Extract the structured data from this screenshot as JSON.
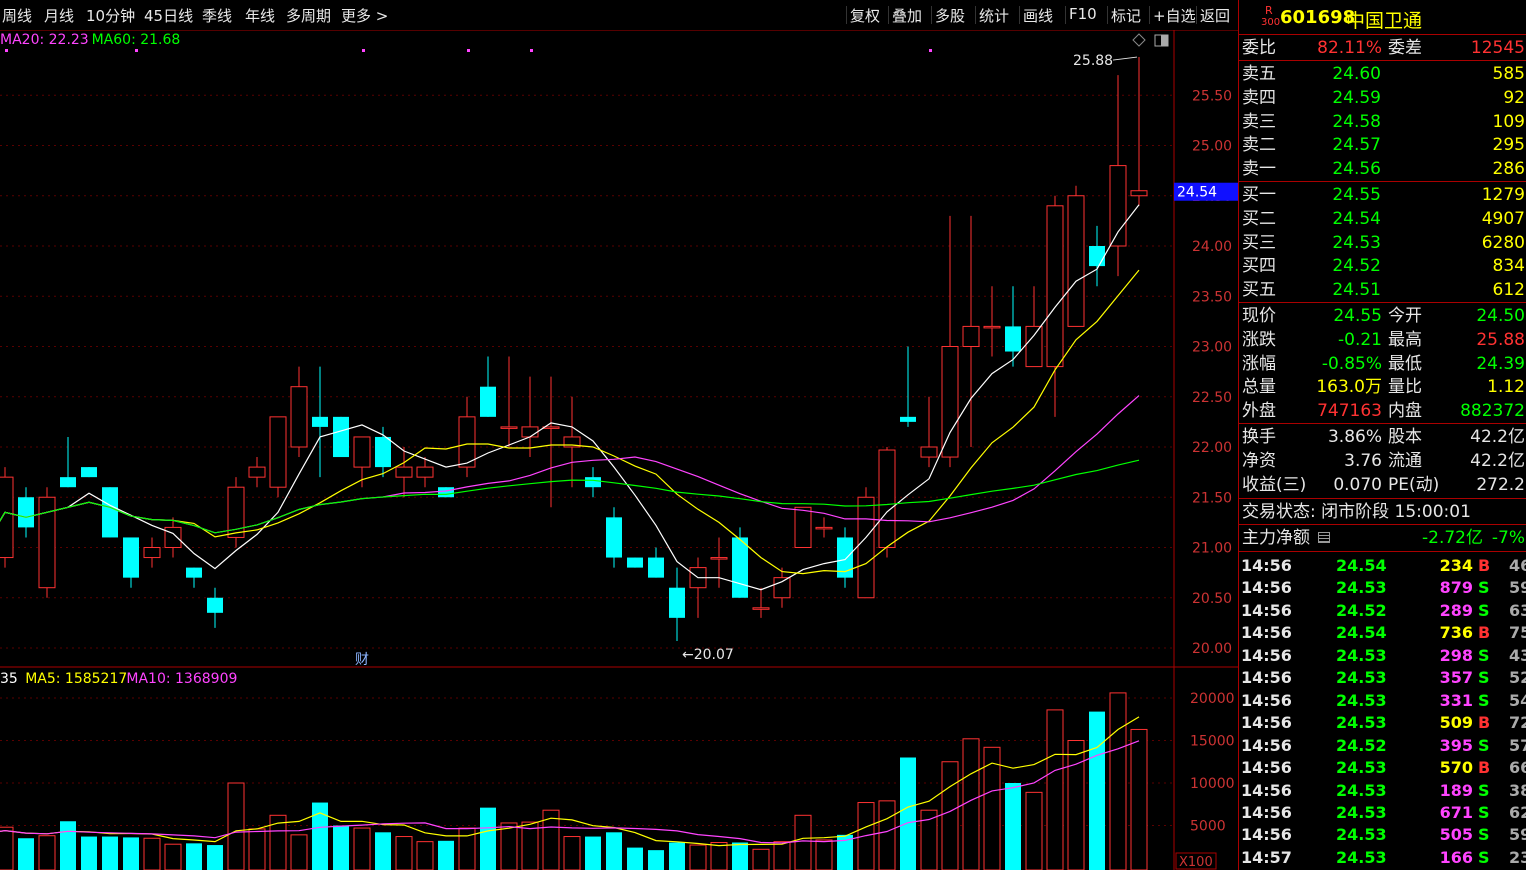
{
  "toolbar": {
    "left_items": [
      "周线",
      "月线",
      "10分钟",
      "45日线",
      "季线",
      "年线",
      "多周期",
      "更多 >"
    ],
    "right_items": [
      "复权",
      "叠加",
      "多股",
      "统计",
      "画线",
      "F10",
      "标记",
      "+自选",
      "返回"
    ]
  },
  "price_chart": {
    "ma_legend": [
      {
        "label": "MA20: 22.23",
        "color": "#ff44ff"
      },
      {
        "label": "MA60: 21.68",
        "color": "#00ff00"
      }
    ],
    "y_ticks": [
      "25.50",
      "25.00",
      "24.50",
      "24.00",
      "23.50",
      "23.00",
      "22.50",
      "22.00",
      "21.50",
      "21.00",
      "20.50",
      "20.00"
    ],
    "current_price_tag": "24.54",
    "high_annotation": "25.88",
    "low_annotation": "20.07",
    "finance_marker": "财",
    "icon_diamond": "diamond-icon",
    "icon_window": "window-icon"
  },
  "volume_chart": {
    "ma_legend": [
      {
        "label": "35",
        "color": "#ffffff"
      },
      {
        "label": "MA5: 1585217",
        "color": "#ffff00"
      },
      {
        "label": "MA10: 1368909",
        "color": "#ff44ff"
      }
    ],
    "y_ticks": [
      "20000",
      "15000",
      "10000",
      "5000"
    ],
    "unit_label": "X100"
  },
  "chart_data": {
    "type": "candlestick",
    "price_ylim": [
      20.0,
      25.8
    ],
    "volume_ylim": [
      0,
      20000
    ],
    "volume_unit": "X100",
    "candles": [
      {
        "o": 21.2,
        "h": 21.4,
        "l": 20.9,
        "c": 21.0,
        "v": 4000
      },
      {
        "o": 20.9,
        "h": 21.8,
        "l": 20.8,
        "c": 21.7,
        "v": 4800
      },
      {
        "o": 21.5,
        "h": 21.6,
        "l": 21.1,
        "c": 21.2,
        "v": 3500
      },
      {
        "o": 20.6,
        "h": 21.6,
        "l": 20.5,
        "c": 21.5,
        "v": 3800
      },
      {
        "o": 21.7,
        "h": 22.1,
        "l": 21.6,
        "c": 21.6,
        "v": 5500
      },
      {
        "o": 21.8,
        "h": 21.8,
        "l": 21.7,
        "c": 21.7,
        "v": 3700
      },
      {
        "o": 21.6,
        "h": 21.6,
        "l": 21.1,
        "c": 21.1,
        "v": 3700
      },
      {
        "o": 21.1,
        "h": 21.1,
        "l": 20.6,
        "c": 20.7,
        "v": 3600
      },
      {
        "o": 20.9,
        "h": 21.1,
        "l": 20.8,
        "c": 21.0,
        "v": 3500
      },
      {
        "o": 21.0,
        "h": 21.3,
        "l": 20.9,
        "c": 21.2,
        "v": 2800
      },
      {
        "o": 20.8,
        "h": 20.8,
        "l": 20.6,
        "c": 20.7,
        "v": 2900
      },
      {
        "o": 20.5,
        "h": 20.6,
        "l": 20.2,
        "c": 20.35,
        "v": 2700
      },
      {
        "o": 21.1,
        "h": 21.7,
        "l": 21.0,
        "c": 21.6,
        "v": 10000
      },
      {
        "o": 21.7,
        "h": 21.9,
        "l": 21.6,
        "c": 21.8,
        "v": 4600
      },
      {
        "o": 21.6,
        "h": 22.3,
        "l": 21.5,
        "c": 22.3,
        "v": 6200
      },
      {
        "o": 22.0,
        "h": 22.8,
        "l": 21.9,
        "c": 22.6,
        "v": 3900
      },
      {
        "o": 22.3,
        "h": 22.8,
        "l": 21.7,
        "c": 22.2,
        "v": 7700
      },
      {
        "o": 22.3,
        "h": 22.3,
        "l": 21.9,
        "c": 21.9,
        "v": 5000
      },
      {
        "o": 21.8,
        "h": 22.1,
        "l": 21.6,
        "c": 22.1,
        "v": 4700
      },
      {
        "o": 22.1,
        "h": 22.2,
        "l": 21.7,
        "c": 21.8,
        "v": 4200
      },
      {
        "o": 21.7,
        "h": 22.0,
        "l": 21.5,
        "c": 21.8,
        "v": 3700
      },
      {
        "o": 21.7,
        "h": 21.9,
        "l": 21.6,
        "c": 21.8,
        "v": 3100
      },
      {
        "o": 21.6,
        "h": 21.6,
        "l": 21.5,
        "c": 21.5,
        "v": 3200
      },
      {
        "o": 21.8,
        "h": 22.5,
        "l": 21.7,
        "c": 22.3,
        "v": 4700
      },
      {
        "o": 22.6,
        "h": 22.9,
        "l": 22.3,
        "c": 22.3,
        "v": 7100
      },
      {
        "o": 22.2,
        "h": 22.9,
        "l": 22.0,
        "c": 22.2,
        "v": 5300
      },
      {
        "o": 22.1,
        "h": 22.7,
        "l": 21.9,
        "c": 22.2,
        "v": 5400
      },
      {
        "o": 22.2,
        "h": 22.7,
        "l": 21.4,
        "c": 22.2,
        "v": 6800
      },
      {
        "o": 22.0,
        "h": 22.5,
        "l": 21.6,
        "c": 22.1,
        "v": 3700
      },
      {
        "o": 21.7,
        "h": 21.8,
        "l": 21.5,
        "c": 21.6,
        "v": 3700
      },
      {
        "o": 21.3,
        "h": 21.4,
        "l": 20.8,
        "c": 20.9,
        "v": 4200
      },
      {
        "o": 20.9,
        "h": 20.9,
        "l": 20.8,
        "c": 20.8,
        "v": 2400
      },
      {
        "o": 20.9,
        "h": 21.0,
        "l": 20.7,
        "c": 20.7,
        "v": 2100
      },
      {
        "o": 20.6,
        "h": 20.8,
        "l": 20.07,
        "c": 20.3,
        "v": 3000
      },
      {
        "o": 20.6,
        "h": 20.9,
        "l": 20.3,
        "c": 20.8,
        "v": 2700
      },
      {
        "o": 20.9,
        "h": 21.1,
        "l": 20.6,
        "c": 20.9,
        "v": 3000
      },
      {
        "o": 21.1,
        "h": 21.2,
        "l": 20.5,
        "c": 20.5,
        "v": 3000
      },
      {
        "o": 20.4,
        "h": 20.6,
        "l": 20.3,
        "c": 20.4,
        "v": 2200
      },
      {
        "o": 20.5,
        "h": 20.8,
        "l": 20.4,
        "c": 20.7,
        "v": 3100
      },
      {
        "o": 21.0,
        "h": 21.4,
        "l": 21.0,
        "c": 21.4,
        "v": 6200
      },
      {
        "o": 21.2,
        "h": 21.3,
        "l": 21.1,
        "c": 21.2,
        "v": 3300
      },
      {
        "o": 21.1,
        "h": 21.2,
        "l": 20.6,
        "c": 20.7,
        "v": 3900
      },
      {
        "o": 20.5,
        "h": 21.6,
        "l": 20.5,
        "c": 21.5,
        "v": 7700
      },
      {
        "o": 21.0,
        "h": 22.0,
        "l": 20.9,
        "c": 21.97,
        "v": 7900
      },
      {
        "o": 22.3,
        "h": 23.0,
        "l": 22.2,
        "c": 22.25,
        "v": 13000
      },
      {
        "o": 21.9,
        "h": 22.5,
        "l": 21.8,
        "c": 22.0,
        "v": 6800
      },
      {
        "o": 21.9,
        "h": 24.3,
        "l": 21.8,
        "c": 23.0,
        "v": 12500
      },
      {
        "o": 23.0,
        "h": 24.3,
        "l": 22.0,
        "c": 23.2,
        "v": 15200
      },
      {
        "o": 23.2,
        "h": 23.6,
        "l": 22.9,
        "c": 23.2,
        "v": 14200
      },
      {
        "o": 23.2,
        "h": 23.6,
        "l": 22.8,
        "c": 22.95,
        "v": 10000
      },
      {
        "o": 22.8,
        "h": 23.6,
        "l": 22.8,
        "c": 23.2,
        "v": 8900
      },
      {
        "o": 22.8,
        "h": 24.5,
        "l": 22.3,
        "c": 24.4,
        "v": 18600
      },
      {
        "o": 23.2,
        "h": 24.6,
        "l": 23.2,
        "c": 24.5,
        "v": 15000
      },
      {
        "o": 24.0,
        "h": 24.2,
        "l": 23.6,
        "c": 23.8,
        "v": 18400
      },
      {
        "o": 24.0,
        "h": 25.7,
        "l": 23.7,
        "c": 24.8,
        "v": 20600
      },
      {
        "o": 24.5,
        "h": 25.88,
        "l": 24.4,
        "c": 24.55,
        "v": 16300
      }
    ]
  },
  "quote": {
    "stock_code": "601698",
    "stock_name": "中国卫通",
    "badge_top": "R",
    "badge_bottom": "300",
    "weibi_label": "委比",
    "weibi_value": "82.11%",
    "weicha_label": "委差",
    "weicha_value": "12545",
    "sell": [
      {
        "label": "卖五",
        "price": "24.60",
        "vol": "585"
      },
      {
        "label": "卖四",
        "price": "24.59",
        "vol": "92"
      },
      {
        "label": "卖三",
        "price": "24.58",
        "vol": "109"
      },
      {
        "label": "卖二",
        "price": "24.57",
        "vol": "295"
      },
      {
        "label": "卖一",
        "price": "24.56",
        "vol": "286"
      }
    ],
    "buy": [
      {
        "label": "买一",
        "price": "24.55",
        "vol": "1279"
      },
      {
        "label": "买二",
        "price": "24.54",
        "vol": "4907"
      },
      {
        "label": "买三",
        "price": "24.53",
        "vol": "6280"
      },
      {
        "label": "买四",
        "price": "24.52",
        "vol": "834"
      },
      {
        "label": "买五",
        "price": "24.51",
        "vol": "612"
      }
    ],
    "stats1": [
      {
        "l1": "现价",
        "v1": "24.55",
        "c1": "g",
        "l2": "今开",
        "v2": "24.50",
        "c2": "g"
      },
      {
        "l1": "涨跌",
        "v1": "-0.21",
        "c1": "g",
        "l2": "最高",
        "v2": "25.88",
        "c2": "r"
      },
      {
        "l1": "涨幅",
        "v1": "-0.85%",
        "c1": "g",
        "l2": "最低",
        "v2": "24.39",
        "c2": "g"
      },
      {
        "l1": "总量",
        "v1": "163.0万",
        "c1": "y",
        "l2": "量比",
        "v2": "1.12",
        "c2": "y"
      },
      {
        "l1": "外盘",
        "v1": "747163",
        "c1": "r",
        "l2": "内盘",
        "v2": "882372",
        "c2": "g"
      }
    ],
    "stats2": [
      {
        "l1": "换手",
        "v1": "3.86%",
        "c1": "w",
        "l2": "股本",
        "v2": "42.2亿",
        "c2": "w"
      },
      {
        "l1": "净资",
        "v1": "3.76",
        "c1": "w",
        "l2": "流通",
        "v2": "42.2亿",
        "c2": "w"
      },
      {
        "l1": "收益(三)",
        "v1": "0.070",
        "c1": "w",
        "l2": "PE(动)",
        "v2": "272.2",
        "c2": "w"
      }
    ],
    "trade_status": "交易状态: 闭市阶段 15:00:01",
    "main_flow_label": "主力净额",
    "main_flow_value": "-2.72亿",
    "main_flow_pct": "-7%"
  },
  "ticks": [
    {
      "t": "14:56",
      "p": "24.54",
      "v": "234",
      "s": "B",
      "n": "46"
    },
    {
      "t": "14:56",
      "p": "24.53",
      "v": "879",
      "s": "S",
      "n": "59"
    },
    {
      "t": "14:56",
      "p": "24.52",
      "v": "289",
      "s": "S",
      "n": "63"
    },
    {
      "t": "14:56",
      "p": "24.54",
      "v": "736",
      "s": "B",
      "n": "75"
    },
    {
      "t": "14:56",
      "p": "24.53",
      "v": "298",
      "s": "S",
      "n": "43"
    },
    {
      "t": "14:56",
      "p": "24.53",
      "v": "357",
      "s": "S",
      "n": "52"
    },
    {
      "t": "14:56",
      "p": "24.53",
      "v": "331",
      "s": "S",
      "n": "54"
    },
    {
      "t": "14:56",
      "p": "24.53",
      "v": "509",
      "s": "B",
      "n": "72"
    },
    {
      "t": "14:56",
      "p": "24.52",
      "v": "395",
      "s": "S",
      "n": "57"
    },
    {
      "t": "14:56",
      "p": "24.53",
      "v": "570",
      "s": "B",
      "n": "66"
    },
    {
      "t": "14:56",
      "p": "24.53",
      "v": "189",
      "s": "S",
      "n": "38"
    },
    {
      "t": "14:56",
      "p": "24.53",
      "v": "671",
      "s": "S",
      "n": "62"
    },
    {
      "t": "14:56",
      "p": "24.53",
      "v": "505",
      "s": "S",
      "n": "59"
    },
    {
      "t": "14:57",
      "p": "24.53",
      "v": "166",
      "s": "S",
      "n": "23"
    }
  ]
}
